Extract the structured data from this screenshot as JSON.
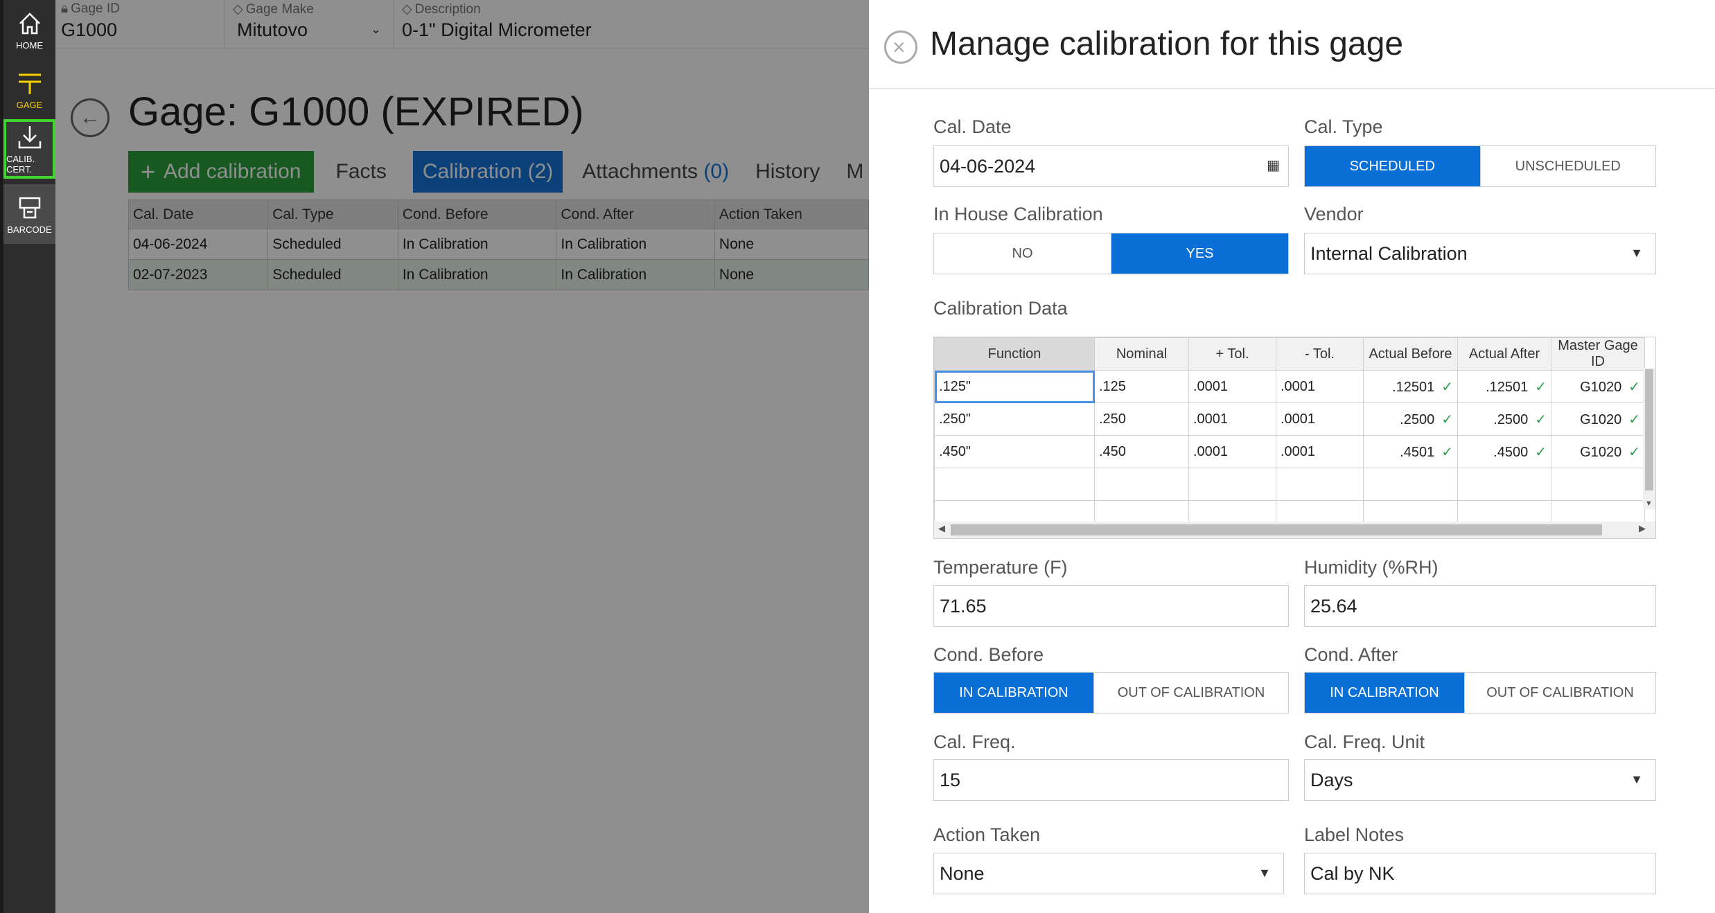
{
  "rail": {
    "items": [
      {
        "label": "HOME",
        "icon": "home-icon"
      },
      {
        "label": "GAGE",
        "icon": "gage-icon"
      },
      {
        "label": "CALIB. CERT.",
        "icon": "download-icon"
      },
      {
        "label": "BARCODE",
        "icon": "barcode-printer-icon"
      }
    ]
  },
  "topbar": {
    "gage_id_label": "Gage ID",
    "gage_id_value": "G1000",
    "gage_make_label": "Gage Make",
    "gage_make_value": "Mitutovo",
    "description_label": "Description",
    "description_value": "0-1\" Digital Micrometer"
  },
  "page": {
    "title": "Gage: G1000 (EXPIRED)",
    "tabs": {
      "add_label": "Add calibration",
      "facts": "Facts",
      "calibration": "Calibration",
      "calibration_count": "(2)",
      "attachments": "Attachments",
      "attachments_count": "(0)",
      "history": "History",
      "more": "M"
    },
    "table": {
      "headers": [
        "Cal. Date",
        "Cal. Type",
        "Cond. Before",
        "Cond. After",
        "Action Taken"
      ],
      "rows": [
        [
          "04-06-2024",
          "Scheduled",
          "In Calibration",
          "In Calibration",
          "None"
        ],
        [
          "02-07-2023",
          "Scheduled",
          "In Calibration",
          "In Calibration",
          "None"
        ]
      ]
    }
  },
  "panel": {
    "title": "Manage calibration for this gage",
    "cal_date_label": "Cal. Date",
    "cal_date_value": "04-06-2024",
    "cal_type_label": "Cal. Type",
    "cal_type_options": [
      "SCHEDULED",
      "UNSCHEDULED"
    ],
    "in_house_label": "In House Calibration",
    "in_house_options": [
      "NO",
      "YES"
    ],
    "vendor_label": "Vendor",
    "vendor_value": "Internal Calibration",
    "cal_data_label": "Calibration Data",
    "grid": {
      "headers": [
        "Function",
        "Nominal",
        "+ Tol.",
        "- Tol.",
        "Actual Before",
        "Actual After",
        "Master Gage ID"
      ],
      "rows": [
        [
          ".125\"",
          ".125",
          ".0001",
          ".0001",
          ".12501",
          ".12501",
          "G1020"
        ],
        [
          ".250\"",
          ".250",
          ".0001",
          ".0001",
          ".2500",
          ".2500",
          "G1020"
        ],
        [
          ".450\"",
          ".450",
          ".0001",
          ".0001",
          ".4501",
          ".4500",
          "G1020"
        ]
      ]
    },
    "temperature_label": "Temperature (F)",
    "temperature_value": "71.65",
    "humidity_label": "Humidity (%RH)",
    "humidity_value": "25.64",
    "cond_before_label": "Cond. Before",
    "cond_before_options": [
      "IN CALIBRATION",
      "OUT OF CALIBRATION"
    ],
    "cond_after_label": "Cond. After",
    "cond_after_options": [
      "IN CALIBRATION",
      "OUT OF CALIBRATION"
    ],
    "cal_freq_label": "Cal. Freq.",
    "cal_freq_value": "15",
    "cal_freq_unit_label": "Cal. Freq. Unit",
    "cal_freq_unit_value": "Days",
    "action_taken_label": "Action Taken",
    "action_taken_value": "None",
    "label_notes_label": "Label Notes",
    "label_notes_value": "Cal by NK"
  },
  "colors": {
    "accent_blue": "#0a6fd6",
    "add_green": "#2c9e3c",
    "highlight_green": "#3fd42e",
    "gage_yellow": "#f5d000",
    "check_green": "#2e9e4f"
  }
}
